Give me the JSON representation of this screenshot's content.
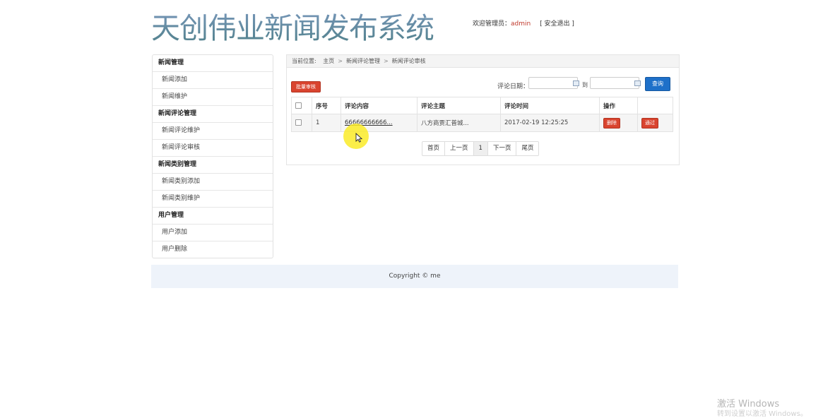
{
  "header": {
    "title": "天创伟业新闻发布系统",
    "welcome_label": "欢迎管理员：",
    "admin_name": "admin",
    "logout_label": "[ 安全退出 ]"
  },
  "sidebar": {
    "groups": [
      {
        "title": "新闻管理",
        "items": [
          "新闻添加",
          "新闻维护"
        ]
      },
      {
        "title": "新闻评论管理",
        "items": [
          "新闻评论维护",
          "新闻评论审核"
        ]
      },
      {
        "title": "新闻类别管理",
        "items": [
          "新闻类别添加",
          "新闻类别维护"
        ]
      },
      {
        "title": "用户管理",
        "items": [
          "用户添加",
          "用户删除"
        ]
      }
    ]
  },
  "breadcrumb": {
    "prefix": "当前位置:",
    "crumbs": [
      "主页",
      "新闻评论管理",
      "新闻评论审核"
    ],
    "separator": ">"
  },
  "toolbar": {
    "batch_label": "批量审核",
    "date_label": "评论日期：",
    "to_label": "到",
    "search_label": "查询",
    "date_from_value": "",
    "date_to_value": ""
  },
  "table": {
    "headers": [
      "序号",
      "评论内容",
      "评论主题",
      "评论时间",
      "操作"
    ],
    "rows": [
      {
        "index": "1",
        "content": "66666666666...",
        "topic": "八方商贾汇普城...",
        "time": "2017-02-19 12:25:25",
        "delete_label": "删除",
        "pass_label": "通过"
      }
    ]
  },
  "pager": {
    "first": "首页",
    "prev": "上一页",
    "current": "1",
    "next": "下一页",
    "last": "尾页"
  },
  "footer": {
    "copyright": "Copyright © me"
  },
  "watermark": {
    "line1": "激活 Windows",
    "line2": "转到设置以激活 Windows。"
  },
  "colors": {
    "danger": "#d9442f",
    "primary": "#1e70c9",
    "footer_bg": "#eef3fa",
    "cursor_highlight": "#faeb28"
  }
}
